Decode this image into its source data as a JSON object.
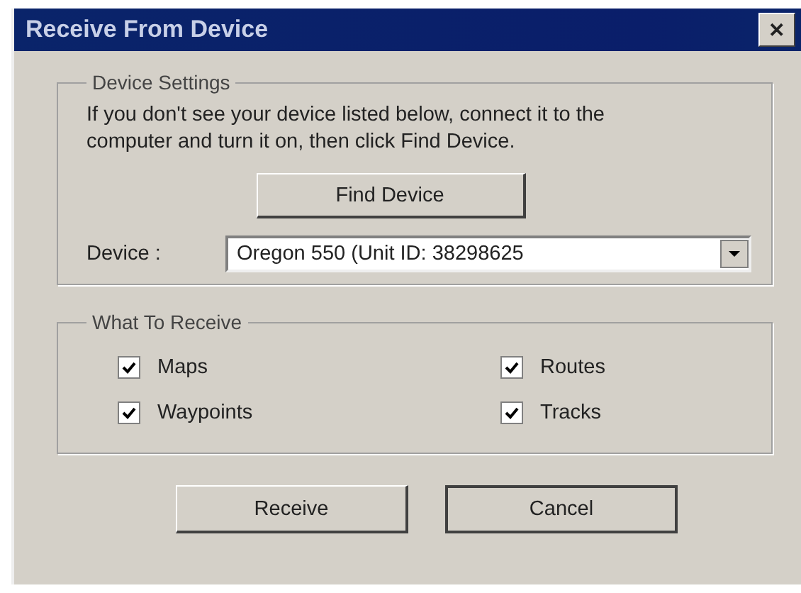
{
  "window": {
    "title": "Receive From Device",
    "close": "✕"
  },
  "device_settings": {
    "title": "Device Settings",
    "instructions": "If you don't see your device listed below, connect it to the computer and turn it on, then click Find Device.",
    "find_button": "Find Device",
    "device_label": "Device :",
    "device_value": "Oregon 550 (Unit ID: 38298625"
  },
  "what_to_receive": {
    "title": "What To Receive",
    "items": [
      {
        "label": "Maps",
        "checked": true
      },
      {
        "label": "Routes",
        "checked": true
      },
      {
        "label": "Waypoints",
        "checked": true
      },
      {
        "label": "Tracks",
        "checked": true
      }
    ]
  },
  "buttons": [
    "Receive",
    "Cancel"
  ]
}
